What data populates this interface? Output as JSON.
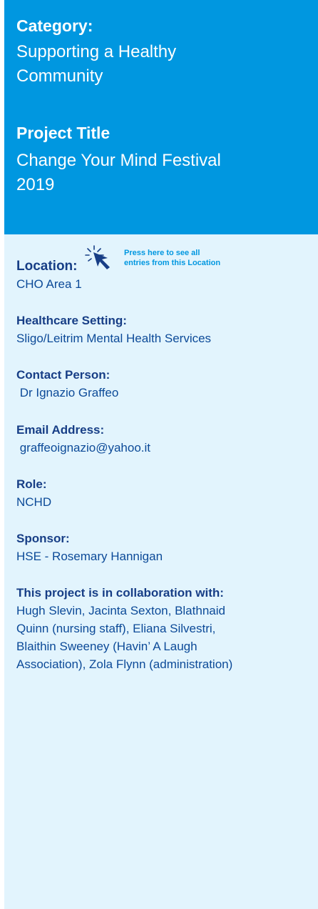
{
  "header": {
    "category_label": "Category:",
    "category_value_line1": "Supporting a Healthy",
    "category_value_line2": "Community",
    "title_label": "Project Title",
    "title_value_line1": "Change Your Mind Festival",
    "title_value_line2": "2019"
  },
  "details": {
    "location_label": "Location:",
    "location_link_line1": "Press here to see all",
    "location_link_line2": "entries from this Location",
    "location_value": "CHO Area 1",
    "setting_label": "Healthcare Setting:",
    "setting_value": "Sligo/Leitrim Mental Health Services",
    "contact_label": "Contact Person:",
    "contact_value": " Dr Ignazio Graffeo",
    "email_label": "Email Address:",
    "email_value": " graffeoignazio@yahoo.it",
    "role_label": "Role:",
    "role_value": "NCHD",
    "sponsor_label": "Sponsor:",
    "sponsor_value": "HSE - Rosemary Hannigan",
    "collab_label": "This project is in collaboration with:",
    "collab_lines": [
      "Hugh Slevin, Jacinta Sexton, Blathnaid",
      "Quinn (nursing staff), Eliana Silvestri,",
      "Blaithin Sweeney (Havin’ A Laugh",
      "Association), Zola Flynn (administration)"
    ]
  },
  "icons": {
    "cursor": "click-cursor-icon"
  },
  "colors": {
    "header_bg": "#0097e0",
    "body_bg": "#e2f4fd",
    "label_text": "#173e86",
    "value_text": "#0c4a98",
    "link_text": "#0097e0"
  }
}
